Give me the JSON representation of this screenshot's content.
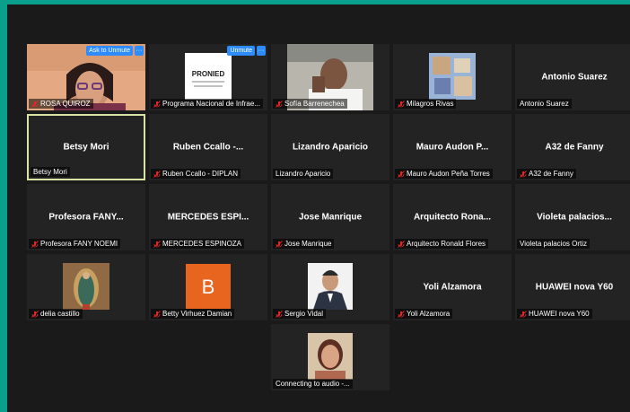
{
  "overlay": {
    "ask_to_unmute": "Ask to Unmute",
    "unmute": "Unmute",
    "more": "···"
  },
  "participants": [
    {
      "label": "ROSA QUIROZ",
      "center": "",
      "muted": true,
      "video": "woman-glasses"
    },
    {
      "label": "Programa Nacional de Infrae...",
      "center": "",
      "muted": true,
      "video": "pronied-logo",
      "logo_text": "PRONIED"
    },
    {
      "label": "Sofía Barrenechea",
      "center": "",
      "muted": true,
      "video": "man-hand"
    },
    {
      "label": "Milagros Rivas",
      "center": "",
      "muted": true,
      "video": "photo-collage"
    },
    {
      "label": "Antonio Suarez",
      "center": "Antonio Suarez",
      "muted": false
    },
    {
      "label": "Betsy Mori",
      "center": "Betsy Mori",
      "muted": false,
      "active": true
    },
    {
      "label": "Ruben Ccallo - DIPLAN",
      "center": "Ruben Ccallo -...",
      "muted": true
    },
    {
      "label": "Lizandro Aparicio",
      "center": "Lizandro Aparicio",
      "muted": false
    },
    {
      "label": "Mauro Audon Peña Torres",
      "center": "Mauro Audon P...",
      "muted": true
    },
    {
      "label": "A32 de Fanny",
      "center": "A32 de Fanny",
      "muted": true
    },
    {
      "label": "Profesora FANY NOEMI",
      "center": "Profesora FANY...",
      "muted": true
    },
    {
      "label": "MERCEDES ESPINOZA",
      "center": "MERCEDES ESPI...",
      "muted": true
    },
    {
      "label": "Jose Manrique",
      "center": "Jose Manrique",
      "muted": true
    },
    {
      "label": "Arquitecto Ronald Flores",
      "center": "Arquitecto Rona...",
      "muted": true
    },
    {
      "label": "Violeta palacios Ortiz",
      "center": "Violeta palacios...",
      "muted": false
    },
    {
      "label": "delia castillo",
      "center": "",
      "muted": true,
      "video": "virgin-image"
    },
    {
      "label": "Betty Virhuez Damian",
      "center": "",
      "muted": true,
      "video": "avatar-letter",
      "letter": "B"
    },
    {
      "label": "Sergio Vidal",
      "center": "",
      "muted": true,
      "video": "man-suit"
    },
    {
      "label": "Yoli Alzamora",
      "center": "Yoli Alzamora",
      "muted": true
    },
    {
      "label": "HUAWEI nova Y60",
      "center": "HUAWEI nova Y60",
      "muted": true
    },
    {
      "label": "Connecting to audio -...",
      "center": "",
      "muted": false,
      "video": "woman-smile",
      "connecting": true
    }
  ],
  "colors": {
    "frame": "#0a9e8c",
    "tile": "#232323",
    "active_border": "#d7e3a4",
    "muted_red": "#e02828",
    "button_blue": "#2d8cff",
    "avatar_orange": "#e8651f"
  }
}
